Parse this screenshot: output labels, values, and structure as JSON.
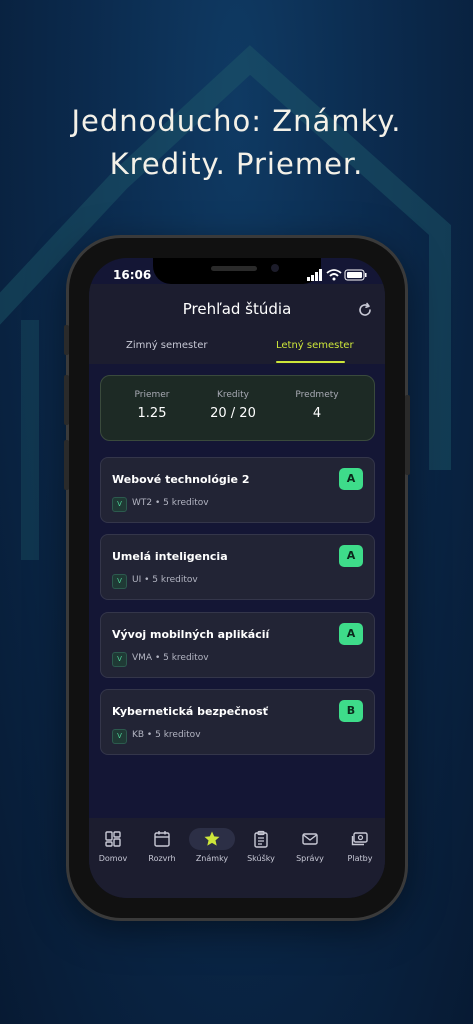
{
  "headline": {
    "line1": "Jednoducho: Známky.",
    "line2": "Kredity. Priemer."
  },
  "status": {
    "time": "16:06"
  },
  "header": {
    "title": "Prehľad štúdia",
    "tabs": [
      {
        "label": "Zimný semester",
        "active": false
      },
      {
        "label": "Letný semester",
        "active": true
      }
    ]
  },
  "summary": [
    {
      "label": "Priemer",
      "value": "1.25"
    },
    {
      "label": "Kredity",
      "value": "20 / 20"
    },
    {
      "label": "Predmety",
      "value": "4"
    }
  ],
  "courses": [
    {
      "name": "Webové technológie 2",
      "type": "V",
      "meta": "WT2 • 5 kreditov",
      "grade": "A"
    },
    {
      "name": "Umelá inteligencia",
      "type": "V",
      "meta": "UI • 5 kreditov",
      "grade": "A"
    },
    {
      "name": "Vývoj mobilných aplikácií",
      "type": "V",
      "meta": "VMA • 5 kreditov",
      "grade": "A"
    },
    {
      "name": "Kybernetická bezpečnosť",
      "type": "V",
      "meta": "KB • 5 kreditov",
      "grade": "B"
    }
  ],
  "nav": [
    {
      "label": "Domov",
      "icon": "dashboard-icon"
    },
    {
      "label": "Rozvrh",
      "icon": "calendar-icon"
    },
    {
      "label": "Známky",
      "icon": "star-icon",
      "active": true
    },
    {
      "label": "Skúšky",
      "icon": "clipboard-icon"
    },
    {
      "label": "Správy",
      "icon": "mail-icon"
    },
    {
      "label": "Platby",
      "icon": "payments-icon"
    }
  ],
  "colors": {
    "accent": "#cde63a",
    "grade": "#3edc8a",
    "background": "#141635"
  }
}
